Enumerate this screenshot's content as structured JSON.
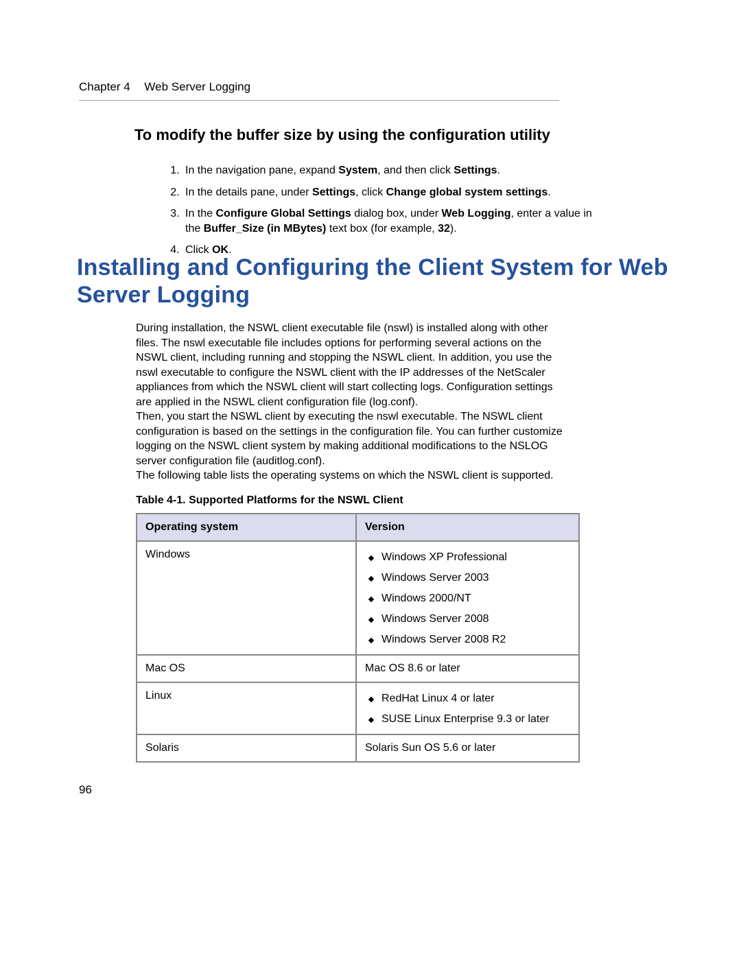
{
  "header": {
    "chapter": "Chapter 4",
    "title": "Web Server Logging"
  },
  "section_h2": "To modify the buffer size by using the configuration utility",
  "steps": {
    "s1a": "In the navigation pane, expand ",
    "s1b": "System",
    "s1c": ", and then click ",
    "s1d": "Settings",
    "s1e": ".",
    "s2a": "In the details pane, under ",
    "s2b": "Settings",
    "s2c": ", click ",
    "s2d": "Change global system settings",
    "s2e": ".",
    "s3a": "In the ",
    "s3b": "Configure Global Settings",
    "s3c": " dialog box, under ",
    "s3d": "Web Logging",
    "s3e": ", enter a value in the ",
    "s3f": "Buffer_Size (in MBytes)",
    "s3g": " text box (for example, ",
    "s3h": "32",
    "s3i": ").",
    "s4a": "Click ",
    "s4b": "OK",
    "s4c": "."
  },
  "h1": "Installing and Configuring the Client System for Web Server Logging",
  "para1": "During installation, the NSWL client executable file (nswl) is installed along with other files. The nswl executable file includes options for performing several actions on the NSWL client, including running and stopping the NSWL client. In addition, you use the nswl executable to configure the NSWL client with the IP addresses of the NetScaler appliances from which the NSWL client will start collecting logs. Configuration settings are applied in the NSWL client configuration file (log.conf).",
  "para2": "Then, you start the NSWL client by executing the nswl executable. The NSWL client configuration is based on the settings in the configuration file. You can further customize logging on the NSWL client system by making additional modifications to the NSLOG server configuration file (auditlog.conf).",
  "para3": "The following table lists the operating systems on which the NSWL client is supported.",
  "table_title": "Table 4-1.  Supported Platforms for the NSWL Client",
  "table": {
    "head_os": "Operating system",
    "head_ver": "Version",
    "rows": {
      "r1_os": "Windows",
      "r1_v": [
        "Windows XP Professional",
        "Windows Server 2003",
        "Windows 2000/NT",
        "Windows Server 2008",
        "Windows Server 2008 R2"
      ],
      "r2_os": "Mac OS",
      "r2_v_text": "Mac OS 8.6 or later",
      "r3_os": "Linux",
      "r3_v": [
        "RedHat Linux 4 or later",
        "SUSE Linux Enterprise 9.3 or later"
      ],
      "r4_os": "Solaris",
      "r4_v_text": "Solaris Sun OS 5.6 or later"
    }
  },
  "page_number": "96"
}
